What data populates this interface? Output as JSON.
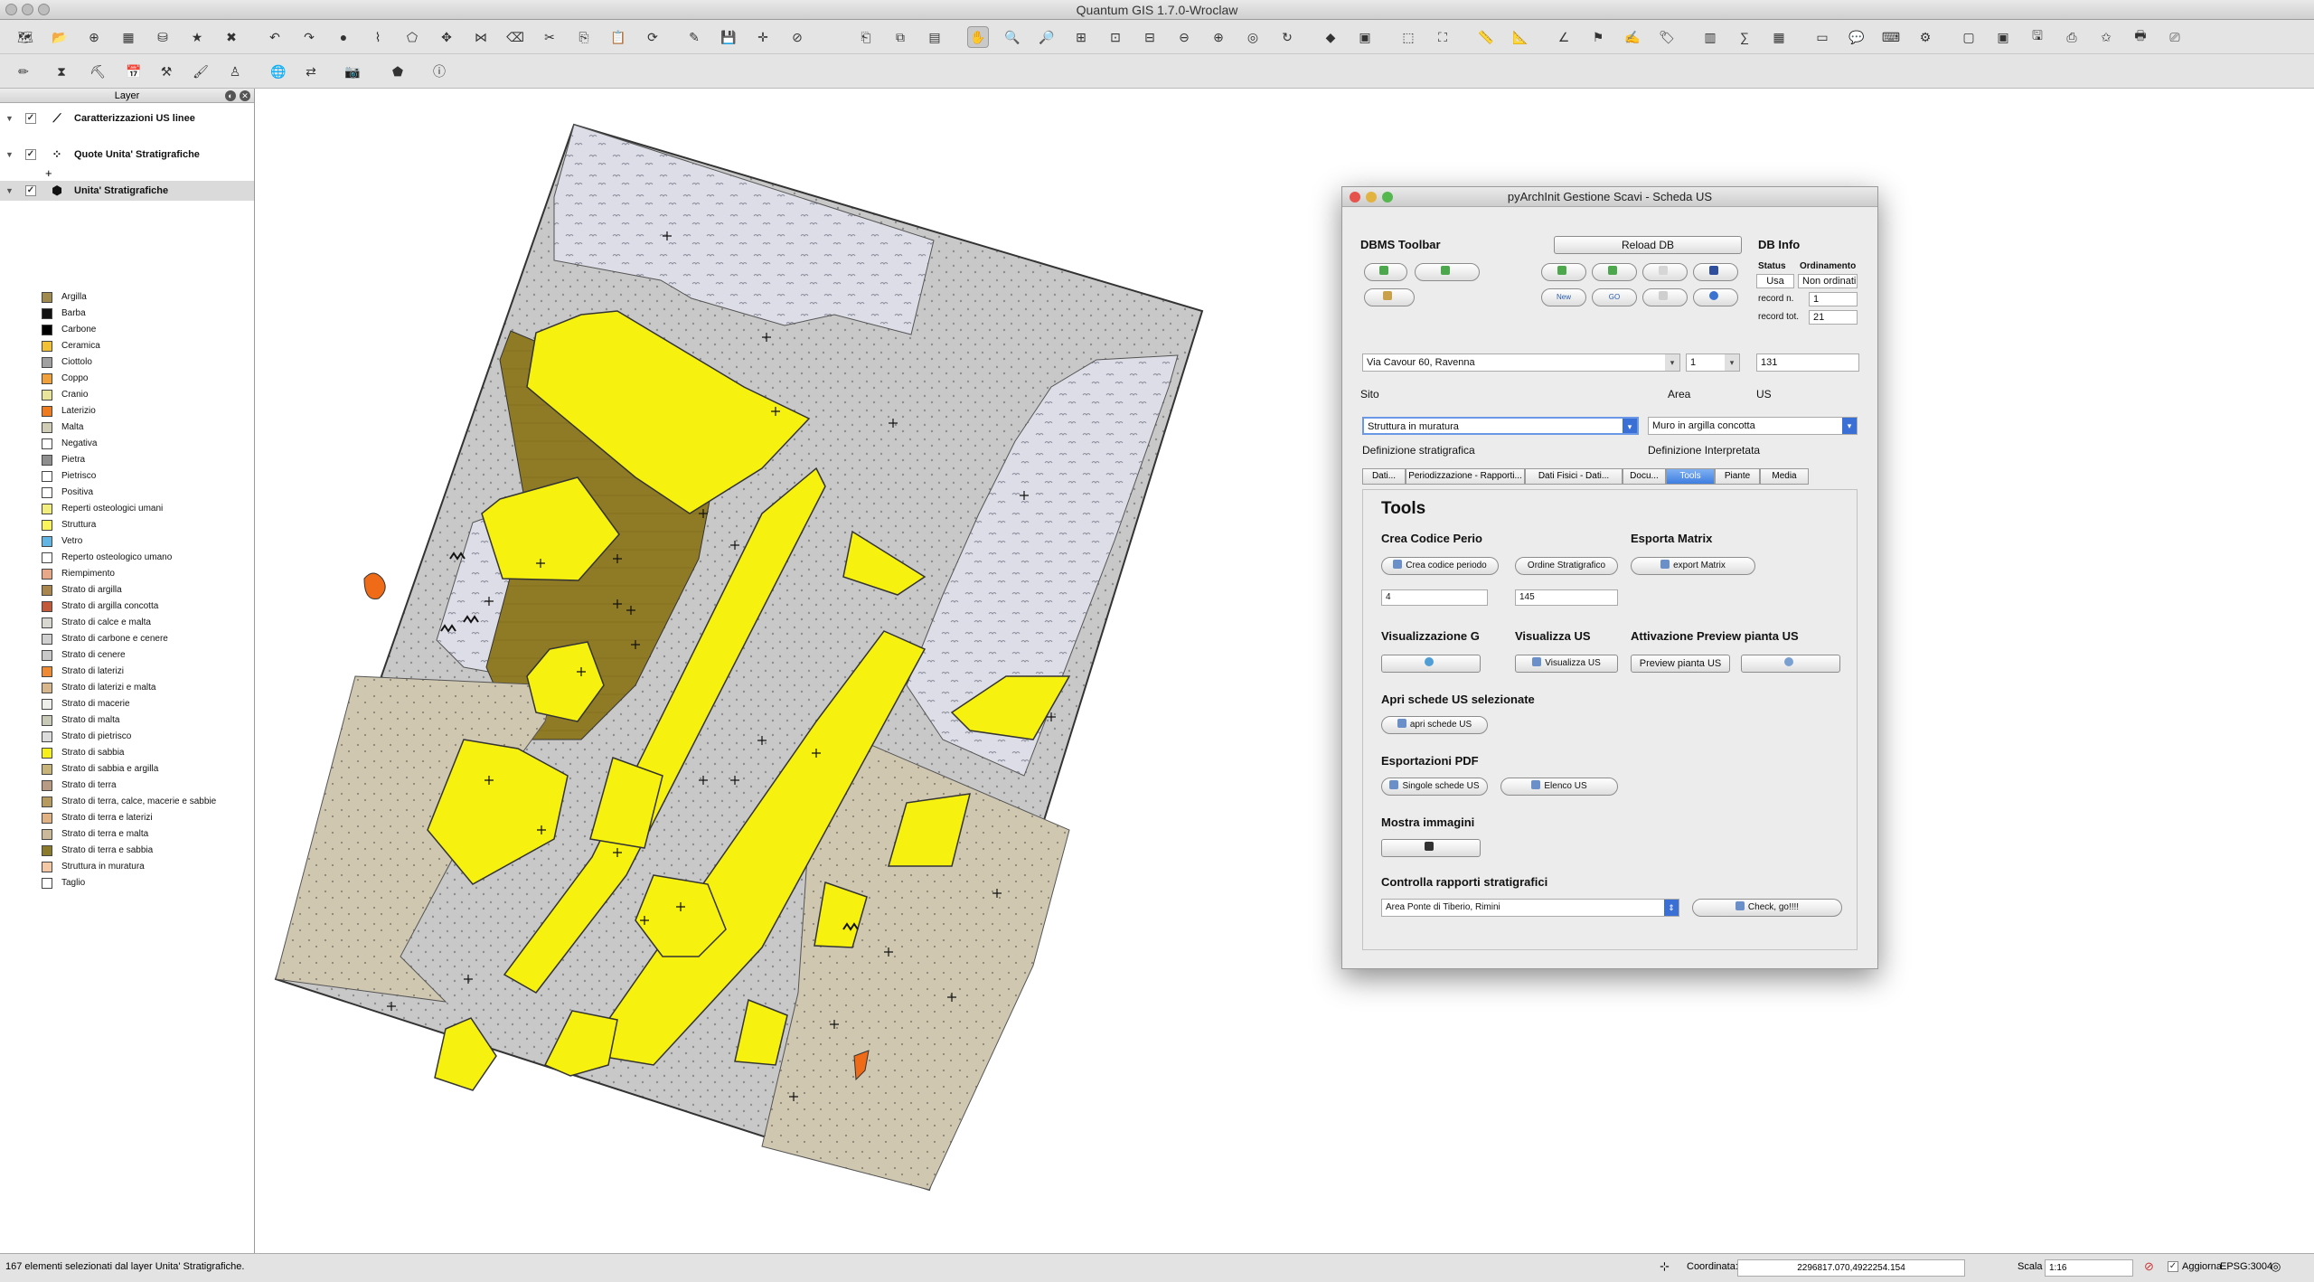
{
  "app": {
    "window_title": "Quantum GIS 1.7.0-Wroclaw"
  },
  "layer_panel": {
    "title": "Layer",
    "layers": [
      {
        "name": "Caratterizzazioni US linee",
        "checked": "✓"
      },
      {
        "name": "Quote Unita' Stratigrafiche",
        "checked": "✓"
      },
      {
        "name": "Unita' Stratigrafiche",
        "checked": "✓"
      }
    ],
    "legend": [
      {
        "label": "Argilla",
        "color": "#a08a4e"
      },
      {
        "label": "Barba",
        "color": "#111111"
      },
      {
        "label": "Carbone",
        "color": "#000000"
      },
      {
        "label": "Ceramica",
        "color": "#f3c234"
      },
      {
        "label": "Ciottolo",
        "color": "#a0a0a0"
      },
      {
        "label": "Coppo",
        "color": "#f2a13a"
      },
      {
        "label": "Cranio",
        "color": "#e8e59a"
      },
      {
        "label": "Laterizio",
        "color": "#f07a1e"
      },
      {
        "label": "Malta",
        "color": "#cfcdb5"
      },
      {
        "label": "Negativa",
        "color": "#ffffff"
      },
      {
        "label": "Pietra",
        "color": "#8e8e8e"
      },
      {
        "label": "Pietrisco",
        "color": "#ffffff"
      },
      {
        "label": "Positiva",
        "color": "#ffffff"
      },
      {
        "label": "Reperti osteologici umani",
        "color": "#f1ee7d"
      },
      {
        "label": "Struttura",
        "color": "#fbf35a"
      },
      {
        "label": "Vetro",
        "color": "#62b6e5"
      },
      {
        "label": "Reperto osteologico umano",
        "color": "#ffffff"
      },
      {
        "label": "Riempimento",
        "color": "#e8a888"
      },
      {
        "label": "Strato di argilla",
        "color": "#a8864c"
      },
      {
        "label": "Strato di argilla concotta",
        "color": "#c4593a"
      },
      {
        "label": "Strato di calce e malta",
        "color": "#d8d8d0"
      },
      {
        "label": "Strato di carbone e cenere",
        "color": "#d0d0d0"
      },
      {
        "label": "Strato di cenere",
        "color": "#c8c8c8"
      },
      {
        "label": "Strato di laterizi",
        "color": "#ef8a32"
      },
      {
        "label": "Strato di laterizi e malta",
        "color": "#d9b78c"
      },
      {
        "label": "Strato di macerie",
        "color": "#eeeeea"
      },
      {
        "label": "Strato di malta",
        "color": "#c9c9b8"
      },
      {
        "label": "Strato di pietrisco",
        "color": "#dcdcdc"
      },
      {
        "label": "Strato di sabbia",
        "color": "#f5f01a"
      },
      {
        "label": "Strato di sabbia e argilla",
        "color": "#c8b478"
      },
      {
        "label": "Strato di terra",
        "color": "#b89b82"
      },
      {
        "label": "Strato di terra, calce, macerie e sabbie",
        "color": "#b79a5e"
      },
      {
        "label": "Strato di terra e laterizi",
        "color": "#e0b283"
      },
      {
        "label": "Strato di terra e malta",
        "color": "#ccb99a"
      },
      {
        "label": "Strato di terra e sabbia",
        "color": "#8a7a2a"
      },
      {
        "label": "Struttura in muratura",
        "color": "#f4c8a4"
      },
      {
        "label": "Taglio",
        "color": "#ffffff"
      }
    ]
  },
  "status_bar": {
    "message": "167 elementi selezionati dal layer Unita' Stratigrafiche.",
    "coord_label": "Coordinata:",
    "coord_value": "2296817.070,4922254.154",
    "scale_label": "Scala",
    "scale_value": "1:16",
    "render_label": "Aggiorna",
    "crs": "EPSG:3004"
  },
  "dialog": {
    "title": "pyArchInit Gestione Scavi - Scheda US",
    "dbms_toolbar": "DBMS Toolbar",
    "reload_db": "Reload DB",
    "db_info": "DB Info",
    "status_label": "Status",
    "status_value": "Usa",
    "order_label": "Ordinamento",
    "order_value": "Non ordinati",
    "record_n_label": "record n.",
    "record_n_value": "1",
    "record_tot_label": "record tot.",
    "record_tot_value": "21",
    "new_label": "New",
    "go_label": "GO",
    "sito_value": "Via Cavour 60, Ravenna",
    "area_value": "1",
    "us_value": "131",
    "sito_label": "Sito",
    "area_label": "Area",
    "us_label": "US",
    "def_strat_value": "Struttura in muratura",
    "def_interp_value": "Muro in argilla concotta",
    "def_strat_label": "Definizione stratigrafica",
    "def_interp_label": "Definizione Interpretata",
    "tabs": [
      "Dati...",
      "Periodizzazione - Rapporti...",
      "Dati Fisici - Dati...",
      "Docu...",
      "Tools",
      "Piante",
      "Media"
    ],
    "tools": {
      "title": "Tools",
      "crea_codice_label": "Crea Codice Perio",
      "esporta_matrix_label": "Esporta Matrix",
      "crea_codice_btn": "Crea codice periodo",
      "ordine_btn": "Ordine Stratigrafico",
      "export_matrix_btn": "export Matrix",
      "field_a": "4",
      "field_b": "145",
      "vis_g_label": "Visualizzazione G",
      "vis_us_label": "Visualizza US",
      "preview_label": "Attivazione Preview pianta US",
      "vis_us_btn": "Visualizza US",
      "preview_btn": "Preview pianta US",
      "apri_label": "Apri schede US selezionate",
      "apri_btn": "apri schede US",
      "pdf_label": "Esportazioni PDF",
      "singole_btn": "Singole schede US",
      "elenco_btn": "Elenco US",
      "immagini_label": "Mostra immagini",
      "controlla_label": "Controlla rapporti stratigrafici",
      "controlla_combo": "Area Ponte di Tiberio, Rimini",
      "check_btn": "Check, go!!!!"
    }
  }
}
